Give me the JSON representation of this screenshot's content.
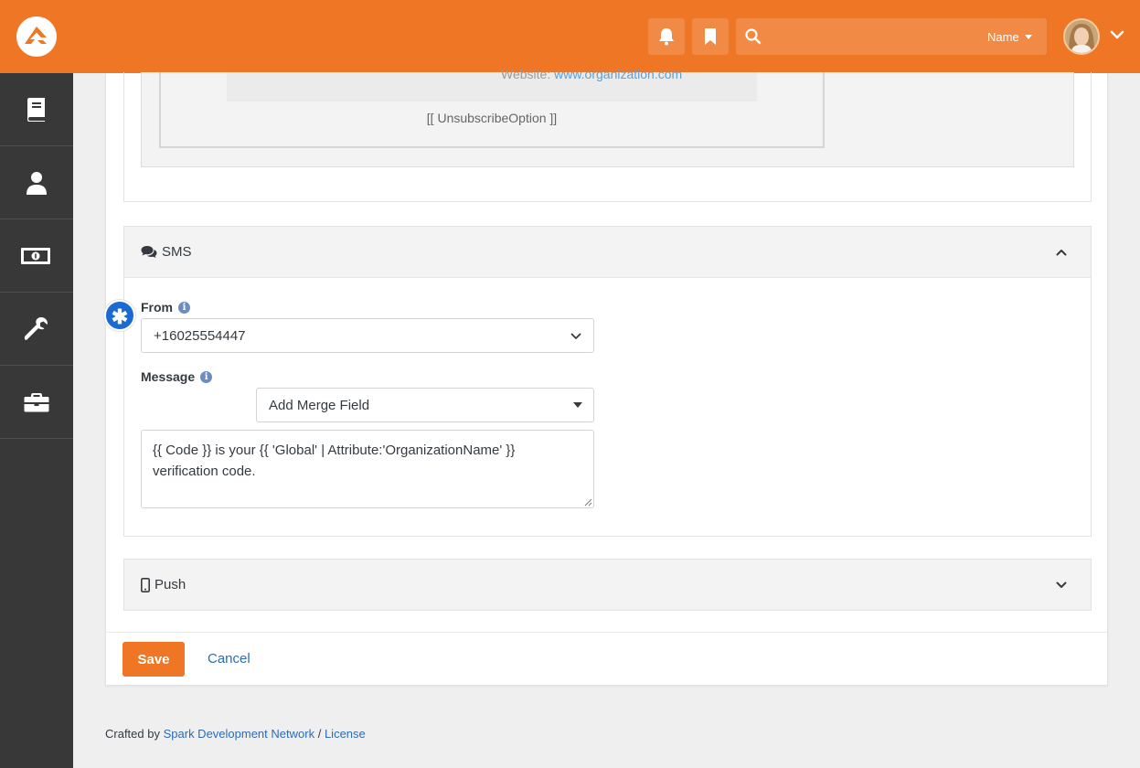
{
  "header": {
    "search_placeholder": "",
    "search_scope": "Name",
    "icons": [
      "bell-icon",
      "bookmark-icon",
      "search-icon",
      "chevron-down-icon"
    ],
    "accent_color": "#ee7625"
  },
  "sidebar": {
    "items": [
      {
        "icon": "book-icon"
      },
      {
        "icon": "person-icon"
      },
      {
        "icon": "money-icon"
      },
      {
        "icon": "wrench-icon"
      },
      {
        "icon": "briefcase-icon"
      }
    ]
  },
  "email_preview": {
    "website_label": "Website:",
    "website_link": "www.organization.com",
    "unsubscribe": "[[ UnsubscribeOption ]]"
  },
  "sms": {
    "title": "SMS",
    "from_label": "From",
    "from_value": "+16025554447",
    "message_label": "Message",
    "merge_field_label": "Add Merge Field",
    "message_value": "{{ Code }} is your {{ 'Global' | Attribute:'OrganizationName' }} verification code."
  },
  "push": {
    "title": "Push"
  },
  "actions": {
    "save_label": "Save",
    "cancel_label": "Cancel"
  },
  "footer": {
    "crafted_by": "Crafted by",
    "org_link": "Spark Development Network",
    "separator": "/",
    "license_link": "License"
  }
}
